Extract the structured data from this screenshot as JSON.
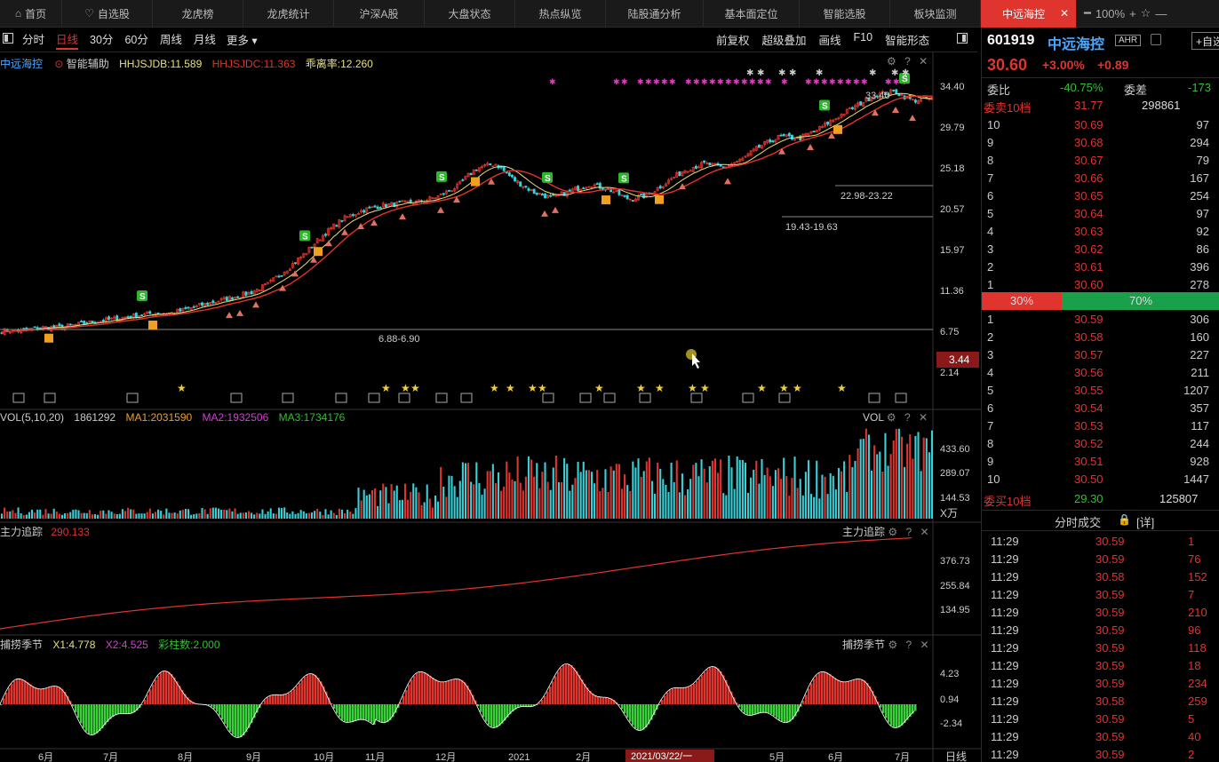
{
  "nav": {
    "tabs": [
      {
        "label": "首页",
        "icon": "home-icon"
      },
      {
        "label": "自选股",
        "icon": "heart-icon"
      },
      {
        "label": "龙虎榜"
      },
      {
        "label": "龙虎统计"
      },
      {
        "label": "沪深A股"
      },
      {
        "label": "大盘状态"
      },
      {
        "label": "热点纵览"
      },
      {
        "label": "陆股通分析"
      },
      {
        "label": "基本面定位"
      },
      {
        "label": "智能选股"
      },
      {
        "label": "板块监测"
      }
    ],
    "active_tab": "中远海控",
    "zoom": "100%"
  },
  "toolbar": {
    "periods": [
      "分时",
      "日线",
      "30分",
      "60分",
      "周线",
      "月线"
    ],
    "more": "更多",
    "right": [
      "前复权",
      "超级叠加",
      "画线",
      "F10",
      "智能形态"
    ]
  },
  "main_legend": {
    "name": "中远海控",
    "assist": "智能辅助",
    "jdb": "HHJSJDB:11.589",
    "jdc": "HHJSJDC:11.363",
    "deviation": "乖离率:12.260"
  },
  "colors": {
    "up": "#e0342e",
    "down": "#3ad0d8",
    "ma": "#e8e07a",
    "bg": "#000000"
  },
  "chart_data": [
    {
      "type": "candlestick",
      "y_axis": [
        "34.40",
        "29.79",
        "25.18",
        "20.57",
        "15.97",
        "11.36",
        "6.75",
        "2.14"
      ],
      "price_tag": "3.44",
      "annotations": [
        "33.40",
        "22.98-23.22",
        "19.43-19.63",
        "6.88-6.90"
      ],
      "close": [
        3.2,
        3.2,
        3.3,
        3.3,
        3.4,
        3.5,
        3.6,
        3.7,
        3.8,
        3.8,
        4.0,
        4.2,
        4.4,
        4.6,
        5.0,
        5.8,
        6.8,
        8.2,
        9.5,
        10.3,
        10.8,
        11.0,
        11.2,
        11.8,
        13.0,
        15.5,
        16.2,
        13.8,
        12.3,
        11.6,
        12.5,
        13.3,
        12.6,
        11.5,
        11.9,
        13.5,
        15.3,
        16.2,
        15.6,
        16.9,
        19.3,
        21.1,
        20.7,
        22.6,
        25.4,
        28.4,
        31.6,
        32.7,
        29.9,
        30.6
      ]
    },
    {
      "type": "bar",
      "legend": "VOL(5,10,20)",
      "value": "1861292",
      "ma1": "MA1:2031590",
      "ma2": "MA2:1932506",
      "ma3": "MA3:1734176",
      "title": "VOL",
      "y_axis": [
        "433.60",
        "289.07",
        "144.53"
      ],
      "unit": "X万"
    },
    {
      "type": "line",
      "legend": "主力追踪",
      "value": "290.133",
      "title": "主力追踪",
      "y_axis": [
        "376.73",
        "255.84",
        "134.95"
      ]
    },
    {
      "type": "bar",
      "legend": "捕捞季节",
      "x1": "X1:4.778",
      "x2": "X2:4.525",
      "bars": "彩柱数:2.000",
      "title": "捕捞季节",
      "y_axis": [
        "4.23",
        "0.94",
        "-2.34"
      ]
    }
  ],
  "x_axis": {
    "months": [
      "6月",
      "7月",
      "8月",
      "9月",
      "10月",
      "11月",
      "12月",
      "2021",
      "2月",
      "2021/03/22/一",
      "5月",
      "6月",
      "7月"
    ],
    "corner": "日线"
  },
  "quote": {
    "code": "601919",
    "name": "中远海控",
    "tag": "AHR",
    "add_btn": "+自选",
    "price": "30.60",
    "pct": "+3.00%",
    "chg": "+0.89",
    "webi_label": "委比",
    "webi": "-40.75%",
    "weicha_label": "委差",
    "weicha": "-173",
    "sell10_label": "委卖10档",
    "sell10_price": "31.77",
    "sell10_vol": "298861",
    "asks": [
      [
        "10",
        "30.69",
        "97"
      ],
      [
        "9",
        "30.68",
        "294"
      ],
      [
        "8",
        "30.67",
        "79"
      ],
      [
        "7",
        "30.66",
        "167"
      ],
      [
        "6",
        "30.65",
        "254"
      ],
      [
        "5",
        "30.64",
        "97"
      ],
      [
        "4",
        "30.63",
        "92"
      ],
      [
        "3",
        "30.62",
        "86"
      ],
      [
        "2",
        "30.61",
        "396"
      ],
      [
        "1",
        "30.60",
        "278"
      ]
    ],
    "ratio_left": "30%",
    "ratio_right": "70%",
    "bids": [
      [
        "1",
        "30.59",
        "306"
      ],
      [
        "2",
        "30.58",
        "160"
      ],
      [
        "3",
        "30.57",
        "227"
      ],
      [
        "4",
        "30.56",
        "211"
      ],
      [
        "5",
        "30.55",
        "1207"
      ],
      [
        "6",
        "30.54",
        "357"
      ],
      [
        "7",
        "30.53",
        "117"
      ],
      [
        "8",
        "30.52",
        "244"
      ],
      [
        "9",
        "30.51",
        "928"
      ],
      [
        "10",
        "30.50",
        "1447"
      ]
    ],
    "buy10_label": "委买10档",
    "buy10_price": "29.30",
    "buy10_vol": "125807",
    "trades_title": "分时成交",
    "trades_detail": "[详]",
    "trades": [
      [
        "11:29",
        "30.59",
        "1"
      ],
      [
        "11:29",
        "30.59",
        "76"
      ],
      [
        "11:29",
        "30.58",
        "152"
      ],
      [
        "11:29",
        "30.59",
        "7"
      ],
      [
        "11:29",
        "30.59",
        "210"
      ],
      [
        "11:29",
        "30.59",
        "96"
      ],
      [
        "11:29",
        "30.59",
        "118"
      ],
      [
        "11:29",
        "30.59",
        "18"
      ],
      [
        "11:29",
        "30.59",
        "234"
      ],
      [
        "11:29",
        "30.58",
        "259"
      ],
      [
        "11:29",
        "30.59",
        "5"
      ],
      [
        "11:29",
        "30.59",
        "40"
      ],
      [
        "11:29",
        "30.59",
        "2"
      ]
    ]
  }
}
